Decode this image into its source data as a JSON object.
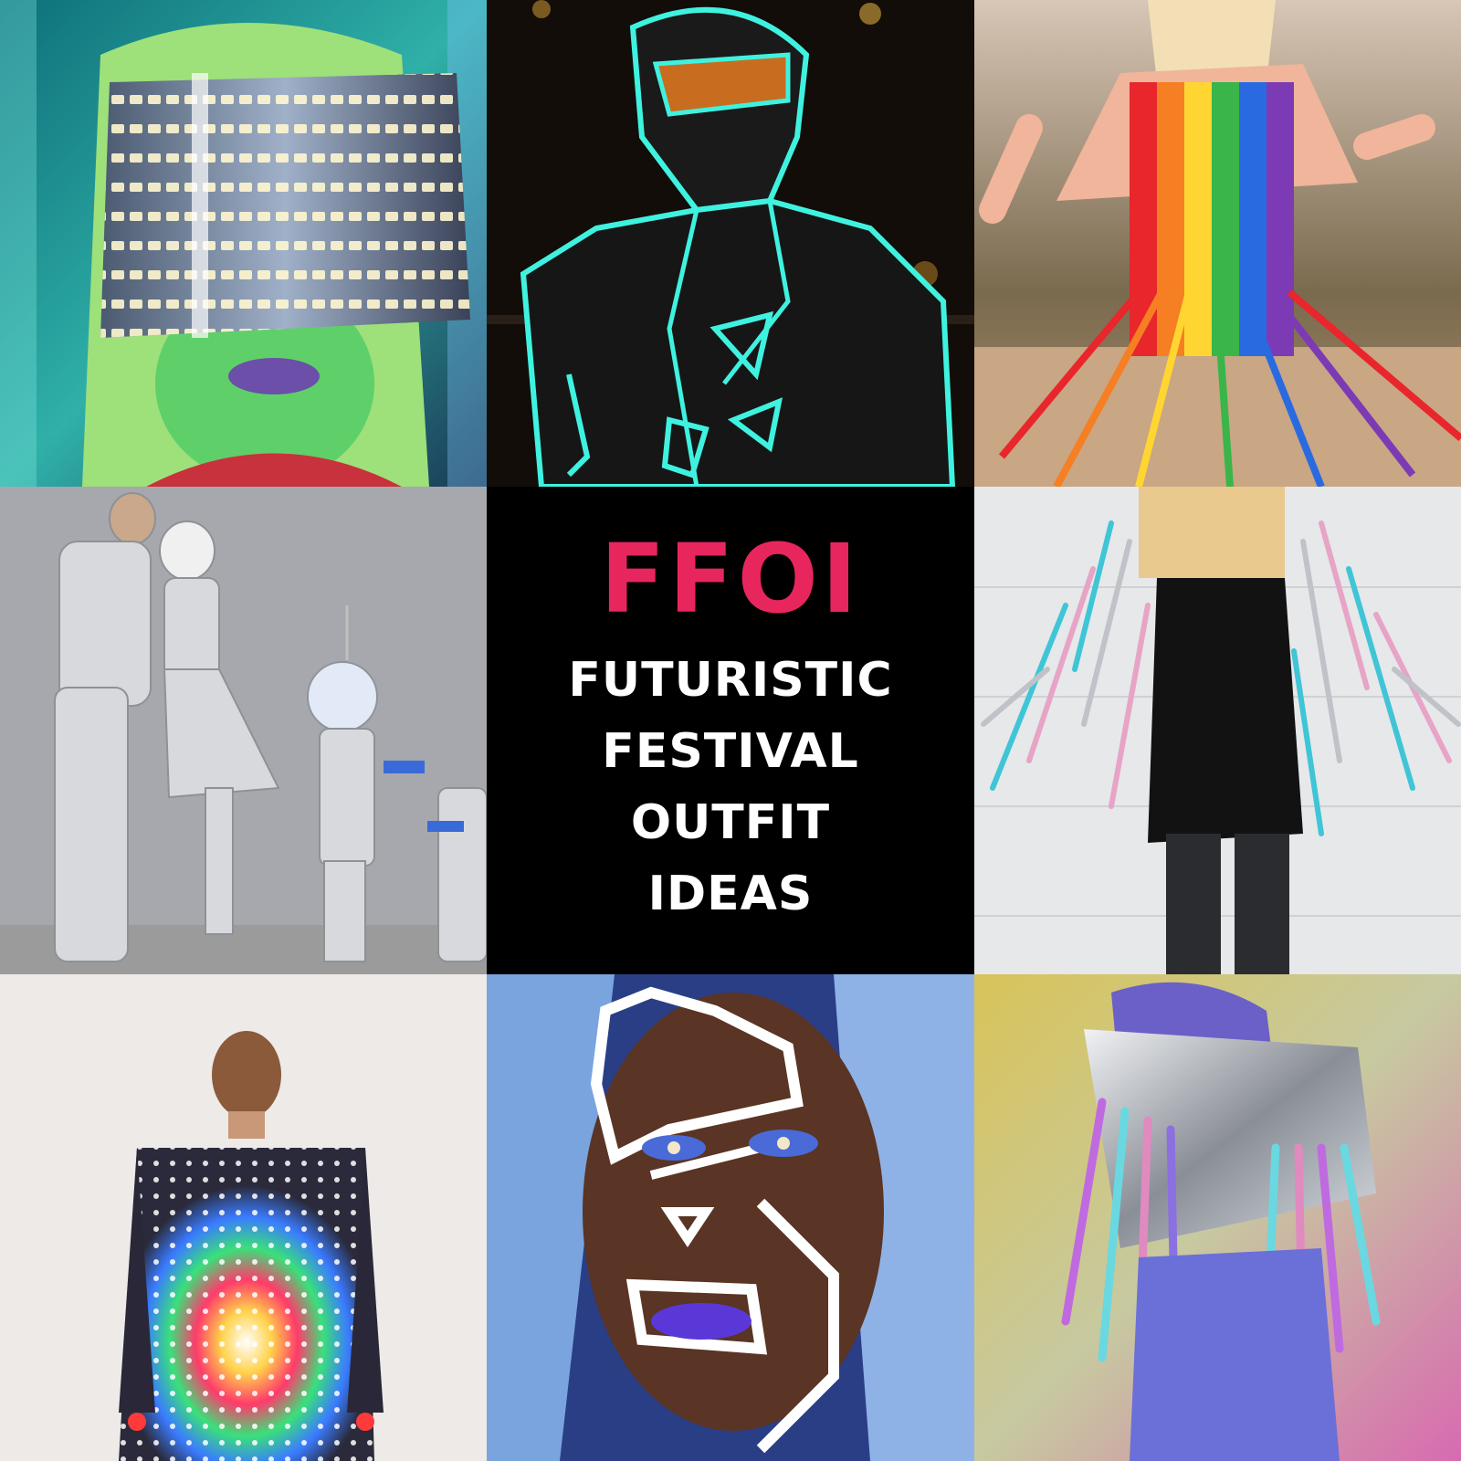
{
  "collage": {
    "brand": "FFOI",
    "title_lines": [
      "FUTURISTIC",
      "FESTIVAL",
      "OUTFIT",
      "IDEAS"
    ]
  },
  "colors": {
    "brand_pink": "#e8265e",
    "center_background": "#000000",
    "title_text": "#ffffff"
  }
}
